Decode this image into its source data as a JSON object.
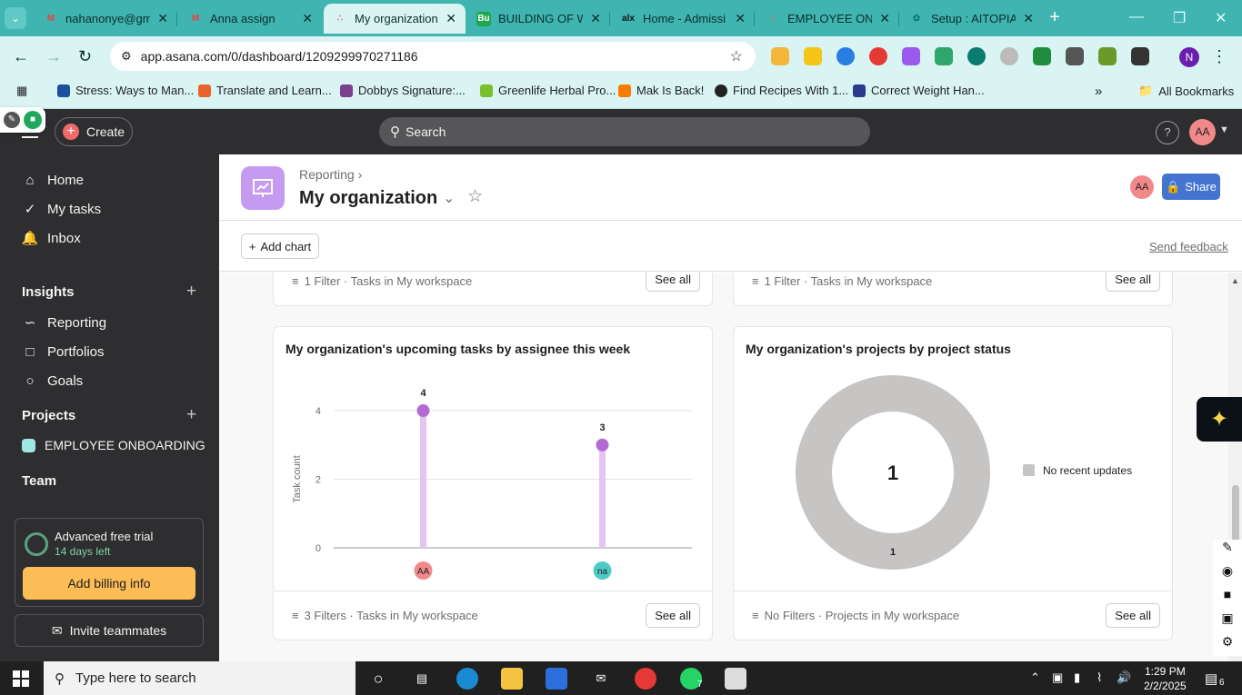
{
  "browser": {
    "tabs": [
      {
        "title": "nahanonye@gm",
        "favicon": "gmail-icon",
        "color": "#ea4335"
      },
      {
        "title": "Anna assign",
        "favicon": "gmail-icon",
        "color": "#ea4335"
      },
      {
        "title": "My organization",
        "favicon": "asana-icon",
        "color": "#f06a6a",
        "active": true
      },
      {
        "title": "BUILDING OF W",
        "favicon": "bu-icon",
        "color": "#1ea84c"
      },
      {
        "title": "Home - Admissi",
        "favicon": "alx-icon",
        "color": "#111111"
      },
      {
        "title": "EMPLOYEE ONB",
        "favicon": "asana-icon",
        "color": "#f06a6a"
      },
      {
        "title": "Setup : AITOPIA",
        "favicon": "chatgpt-icon",
        "color": "#0b7a70"
      }
    ],
    "url": "app.asana.com/0/dashboard/1209299970271186",
    "bookmarks": [
      {
        "label": "Stress: Ways to Man...",
        "color": "#1d4f9c"
      },
      {
        "label": "Translate and Learn...",
        "color": "#e8642c"
      },
      {
        "label": "Dobbys Signature:...",
        "color": "#7b3f8c"
      },
      {
        "label": "Greenlife Herbal Pro...",
        "color": "#7bbf2a"
      },
      {
        "label": "Mak Is Back!",
        "color": "#f57d00"
      },
      {
        "label": "Find Recipes With 1...",
        "color": "#222222"
      },
      {
        "label": "Correct Weight Han...",
        "color": "#2a3a8c"
      }
    ],
    "all_bookmarks": "All Bookmarks",
    "profile_initial": "N"
  },
  "topbar": {
    "create_label": "Create",
    "search_placeholder": "Search",
    "help_label": "?",
    "user_initials": "AA"
  },
  "sidebar": {
    "nav": [
      {
        "label": "Home",
        "icon": "home-icon"
      },
      {
        "label": "My tasks",
        "icon": "check-circle-icon"
      },
      {
        "label": "Inbox",
        "icon": "bell-icon"
      }
    ],
    "insights_heading": "Insights",
    "insights": [
      {
        "label": "Reporting",
        "icon": "reporting-icon"
      },
      {
        "label": "Portfolios",
        "icon": "folder-icon"
      },
      {
        "label": "Goals",
        "icon": "goals-icon"
      }
    ],
    "projects_heading": "Projects",
    "projects": [
      {
        "label": "EMPLOYEE ONBOARDING",
        "color": "#9ee7e3"
      }
    ],
    "team_heading": "Team",
    "trial_title": "Advanced free trial",
    "trial_days": "14 days left",
    "billing_button": "Add billing info",
    "invite_button": "Invite teammates"
  },
  "page": {
    "breadcrumb": "Reporting",
    "title": "My organization",
    "member_initials": "AA",
    "share_label": "Share",
    "add_chart_label": "Add chart",
    "feedback_label": "Send feedback"
  },
  "cards_top": [
    {
      "filter_text": "1 Filter · Tasks in My workspace",
      "see_all": "See all"
    },
    {
      "filter_text": "1 Filter · Tasks in My workspace",
      "see_all": "See all"
    }
  ],
  "cards": {
    "left": {
      "title": "My organization's upcoming tasks by assignee this week",
      "filter_text": "3 Filters · Tasks in My workspace",
      "see_all": "See all"
    },
    "right": {
      "title": "My organization's projects by project status",
      "filter_text": "No Filters · Projects in My workspace",
      "see_all": "See all"
    }
  },
  "chart_data": [
    {
      "type": "bar",
      "title": "My organization's upcoming tasks by assignee this week",
      "ylabel": "Task count",
      "xlabel": "",
      "categories": [
        "AA",
        "na"
      ],
      "category_colors": [
        "#f1898b",
        "#4ecbc4"
      ],
      "values": [
        4,
        3
      ],
      "yticks": [
        0,
        2,
        4
      ],
      "ylim": [
        0,
        4
      ],
      "grid": true,
      "color": "#e3c5ef",
      "marker_color": "#b36bd4"
    },
    {
      "type": "pie",
      "title": "My organization's projects by project status",
      "center_label": "1",
      "slices": [
        {
          "label": "No recent updates",
          "value": 1,
          "color": "#c7c4c4"
        }
      ],
      "legend": "right"
    }
  ],
  "taskbar": {
    "search_placeholder": "Type here to search",
    "time": "1:29 PM",
    "date": "2/2/2025",
    "notifications": "6",
    "whatsapp_badge": "7"
  }
}
